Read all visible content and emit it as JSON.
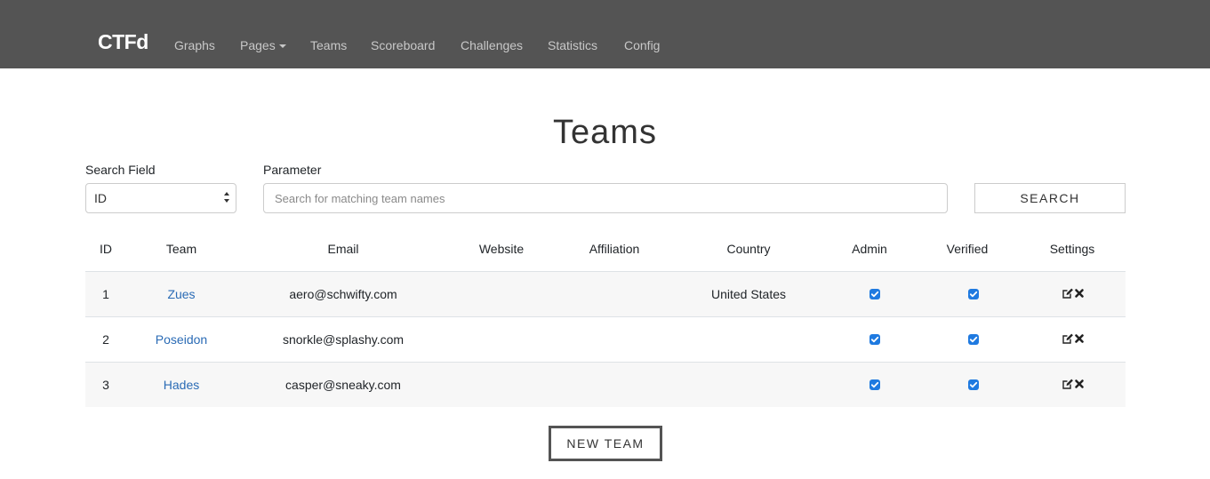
{
  "navbar": {
    "brand": "CTFd",
    "items": [
      {
        "label": "Graphs"
      },
      {
        "label": "Pages",
        "dropdown": true
      },
      {
        "label": "Teams"
      },
      {
        "label": "Scoreboard"
      },
      {
        "label": "Challenges"
      },
      {
        "label": "Statistics"
      },
      {
        "label": "Config"
      }
    ]
  },
  "page": {
    "title": "Teams"
  },
  "search": {
    "field_label": "Search Field",
    "field_value": "ID",
    "parameter_label": "Parameter",
    "placeholder": "Search for matching team names",
    "button_label": "SEARCH"
  },
  "table": {
    "columns": [
      "ID",
      "Team",
      "Email",
      "Website",
      "Affiliation",
      "Country",
      "Admin",
      "Verified",
      "Settings"
    ],
    "rows": [
      {
        "id": "1",
        "team": "Zues",
        "email": "aero@schwifty.com",
        "website": "",
        "affiliation": "",
        "country": "United States",
        "admin": true,
        "verified": true
      },
      {
        "id": "2",
        "team": "Poseidon",
        "email": "snorkle@splashy.com",
        "website": "",
        "affiliation": "",
        "country": "",
        "admin": true,
        "verified": true
      },
      {
        "id": "3",
        "team": "Hades",
        "email": "casper@sneaky.com",
        "website": "",
        "affiliation": "",
        "country": "",
        "admin": true,
        "verified": true
      }
    ]
  },
  "actions": {
    "new_team_label": "NEW TEAM"
  },
  "colors": {
    "navbar_bg": "#545454",
    "link": "#2a6bb5",
    "checkbox": "#1f7ae0",
    "stripe": "#f7f7f7"
  },
  "icons": {
    "edit": "edit-icon",
    "delete": "delete-icon",
    "checkbox": "checkbox-checked-icon"
  }
}
